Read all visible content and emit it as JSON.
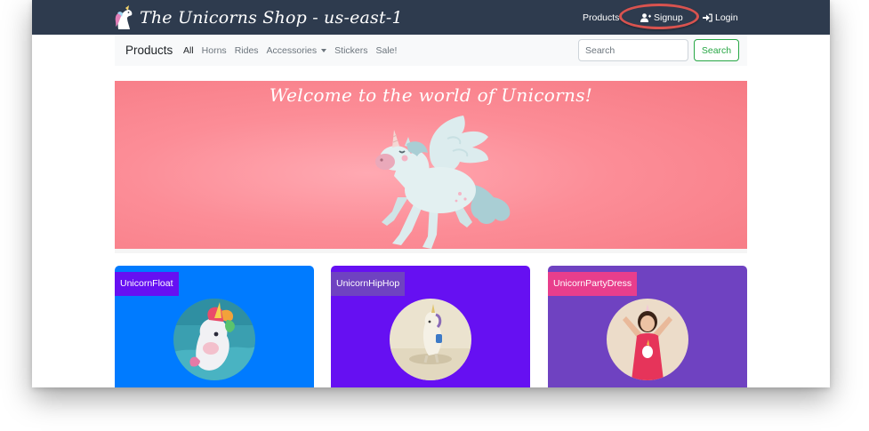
{
  "header": {
    "brand": "The Unicorns Shop - us-east-1",
    "nav": [
      {
        "label": "Products",
        "icon": "none"
      },
      {
        "label": "Signup",
        "icon": "user-plus-icon"
      },
      {
        "label": "Login",
        "icon": "sign-in-icon"
      }
    ],
    "highlight_color": "#d9534f",
    "background": "#2e3b4e"
  },
  "subnav": {
    "title": "Products",
    "filters": [
      "All",
      "Horns",
      "Rides",
      "Accessories",
      "Stickers",
      "Sale!"
    ],
    "active_filter": "All",
    "dropdown_filter": "Accessories",
    "search": {
      "placeholder": "Search",
      "value": "",
      "button_label": "Search",
      "button_color": "#28a745"
    }
  },
  "banner": {
    "title": "Welcome to the world of Unicorns!",
    "background": "#f67a84"
  },
  "cards": [
    {
      "name": "UnicornFloat",
      "card_color": "#007bff",
      "label_color": "#6610f2"
    },
    {
      "name": "UnicornHipHop",
      "card_color": "#6610f2",
      "label_color": "#6f42c1"
    },
    {
      "name": "UnicornPartyDress",
      "card_color": "#6f42c1",
      "label_color": "#e83e8c"
    }
  ]
}
